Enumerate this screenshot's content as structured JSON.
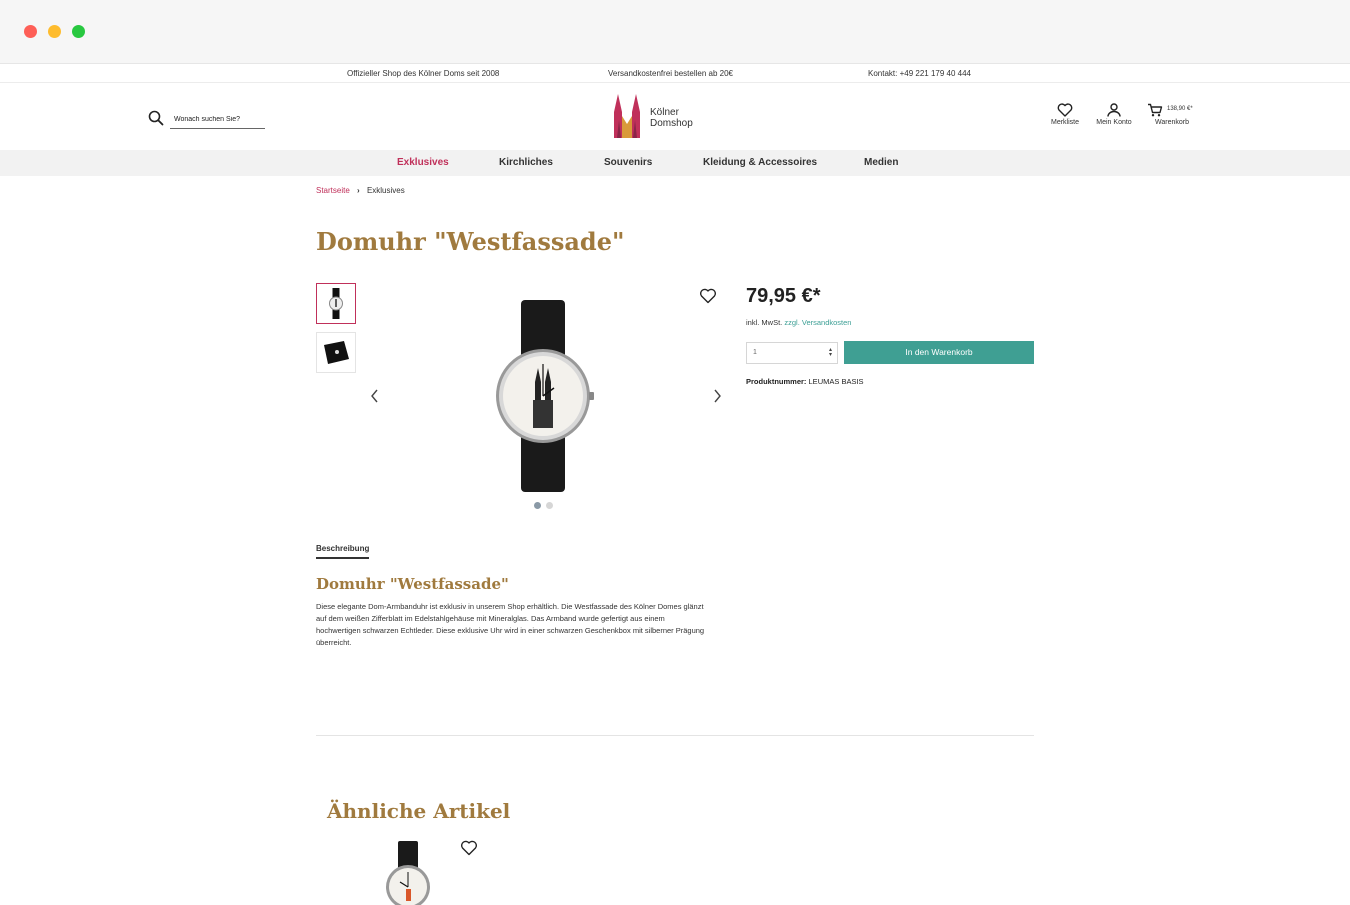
{
  "window": {
    "controls": [
      "close",
      "minimize",
      "maximize"
    ]
  },
  "topbar": {
    "left": "Offizieller Shop des Kölner Doms seit 2008",
    "center": "Versandkostenfrei bestellen ab 20€",
    "right": "Kontakt: +49 221 179 40 444"
  },
  "header": {
    "search_placeholder": "Wonach suchen Sie?",
    "logo_line1": "Kölner",
    "logo_line2": "Domshop",
    "wishlist_label": "Merkliste",
    "account_label": "Mein Konto",
    "cart_label": "Warenkorb",
    "cart_total": "138,90 €*"
  },
  "nav": {
    "items": [
      "Exklusives",
      "Kirchliches",
      "Souvenirs",
      "Kleidung & Accessoires",
      "Medien"
    ],
    "active": "Exklusives"
  },
  "breadcrumb": {
    "home": "Startseite",
    "current": "Exklusives"
  },
  "product": {
    "title": "Domuhr \"Westfassade\"",
    "price": "79,95 €*",
    "tax_text": "inkl. MwSt.",
    "shipping_link": "zzgl. Versandkosten",
    "quantity": "1",
    "add_to_cart_label": "In den Warenkorb",
    "sku_label": "Produktnummer:",
    "sku_value": "LEUMAS BASIS",
    "gallery": {
      "image_count": 2,
      "active_index": 0
    }
  },
  "description": {
    "tab_label": "Beschreibung",
    "title": "Domuhr \"Westfassade\"",
    "text": "Diese elegante Dom-Armbanduhr ist exklusiv in unserem Shop erhältlich. Die Westfassade des Kölner Domes glänzt auf dem weißen Zifferblatt im Edelstahlgehäuse mit Mineralglas. Das Armband wurde gefertigt aus einem hochwertigen schwarzen Echtleder. Diese exklusive Uhr wird in einer schwarzen Geschenkbox mit silberner Prägung überreicht."
  },
  "similar": {
    "title": "Ähnliche Artikel"
  },
  "colors": {
    "accent_pink": "#c0305a",
    "title_gold": "#a07a3e",
    "button_teal": "#3f9f93",
    "link_teal": "#3c9f95"
  },
  "icons": [
    "search-icon",
    "heart-icon",
    "user-icon",
    "cart-icon",
    "chevron-left-icon",
    "chevron-right-icon",
    "breadcrumb-arrow-icon"
  ]
}
